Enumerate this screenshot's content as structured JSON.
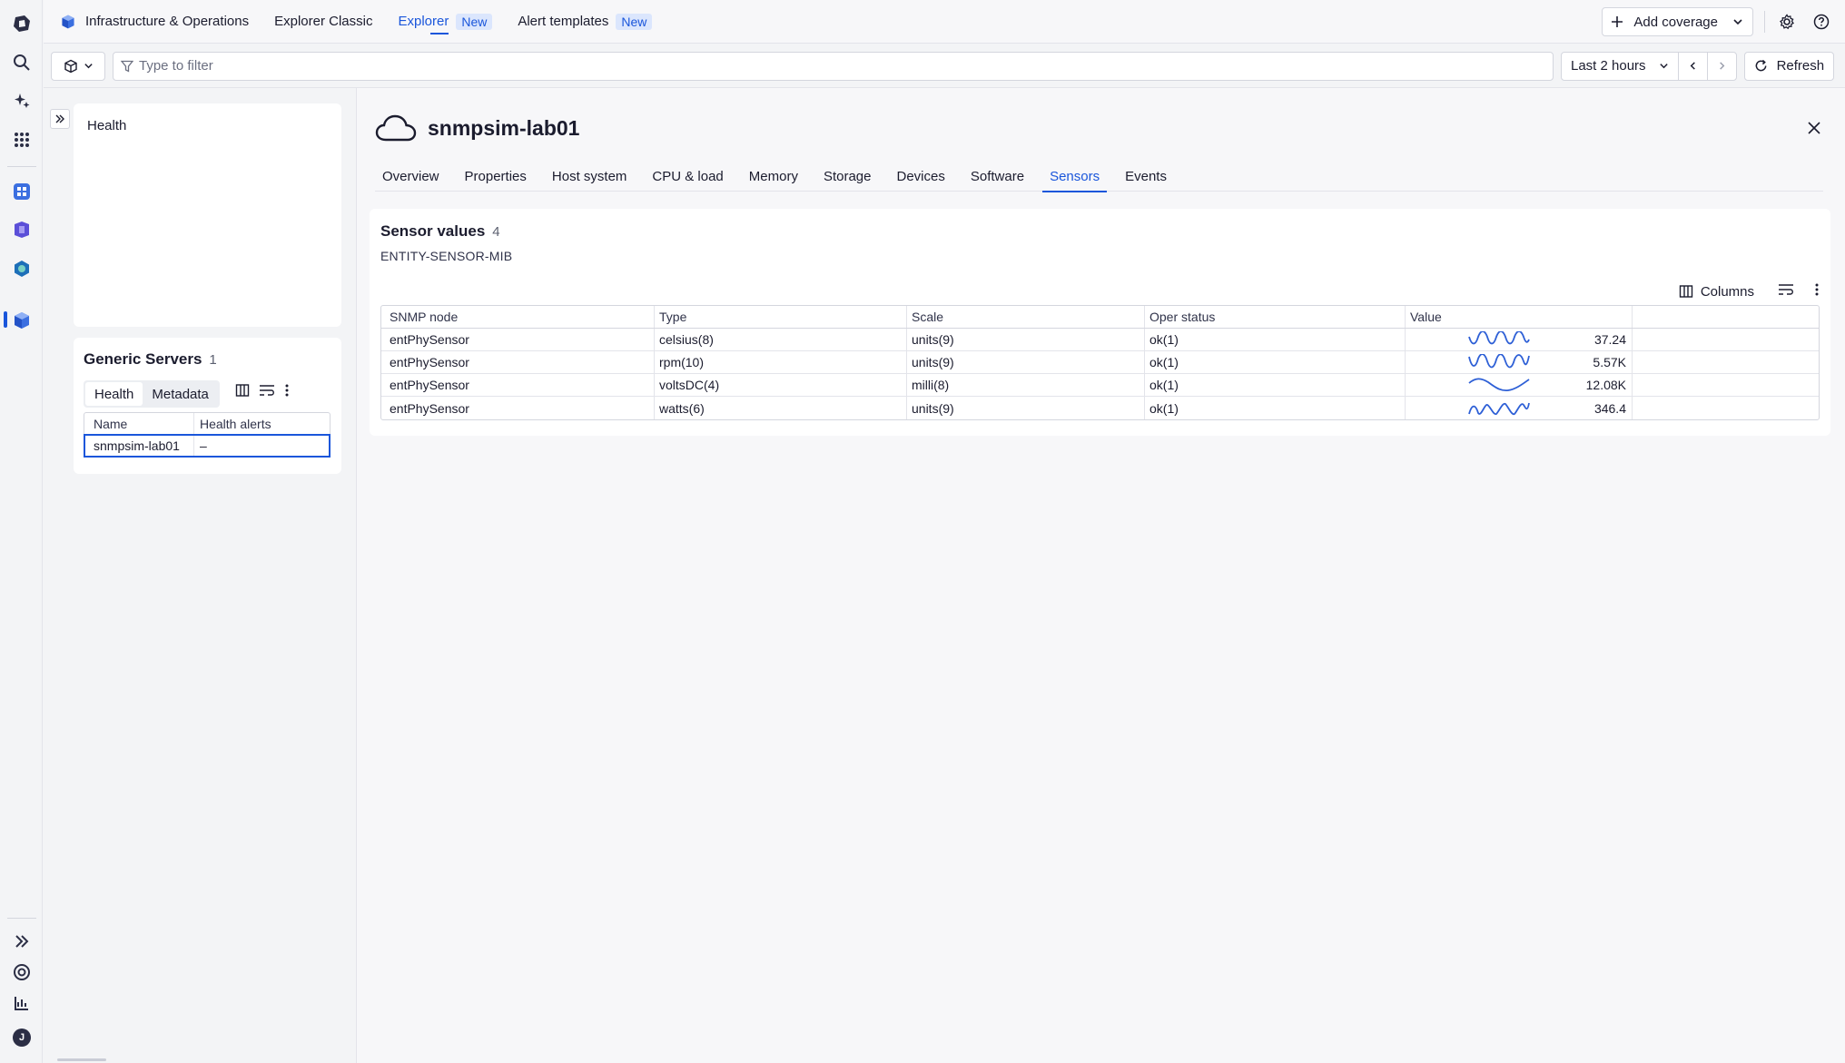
{
  "app": {
    "title": "Infrastructure & Operations",
    "tabs": [
      {
        "label": "Explorer Classic",
        "badge": ""
      },
      {
        "label": "Explorer",
        "badge": "New"
      },
      {
        "label": "Alert templates",
        "badge": "New"
      }
    ]
  },
  "header_right": {
    "add_coverage": "Add coverage"
  },
  "filter": {
    "placeholder": "Type to filter",
    "timeframe": "Last 2 hours",
    "refresh": "Refresh"
  },
  "sidebar": {
    "health_title": "Health",
    "group_title": "Generic Servers",
    "group_count": "1",
    "segments": [
      "Health",
      "Metadata"
    ],
    "columns": [
      "Name",
      "Health alerts"
    ],
    "rows": [
      {
        "name": "snmpsim-lab01",
        "health": "–"
      }
    ]
  },
  "entity": {
    "name": "snmpsim-lab01",
    "tabs": [
      "Overview",
      "Properties",
      "Host system",
      "CPU & load",
      "Memory",
      "Storage",
      "Devices",
      "Software",
      "Sensors",
      "Events"
    ],
    "active_tab": "Sensors"
  },
  "sensors": {
    "title": "Sensor values",
    "count": "4",
    "mib": "ENTITY-SENSOR-MIB",
    "columns_label": "Columns",
    "headers": [
      "SNMP node",
      "Type",
      "Scale",
      "Oper status",
      "Value"
    ],
    "rows": [
      {
        "node": "entPhySensor",
        "type": "celsius(8)",
        "scale": "units(9)",
        "oper": "ok(1)",
        "value": "37.24"
      },
      {
        "node": "entPhySensor",
        "type": "rpm(10)",
        "scale": "units(9)",
        "oper": "ok(1)",
        "value": "5.57K"
      },
      {
        "node": "entPhySensor",
        "type": "voltsDC(4)",
        "scale": "milli(8)",
        "oper": "ok(1)",
        "value": "12.08K"
      },
      {
        "node": "entPhySensor",
        "type": "watts(6)",
        "scale": "units(9)",
        "oper": "ok(1)",
        "value": "346.4"
      }
    ]
  },
  "colors": {
    "accent": "#1a56db",
    "badge_bg": "#dbe6fd"
  },
  "profile": {
    "initial": "J"
  }
}
